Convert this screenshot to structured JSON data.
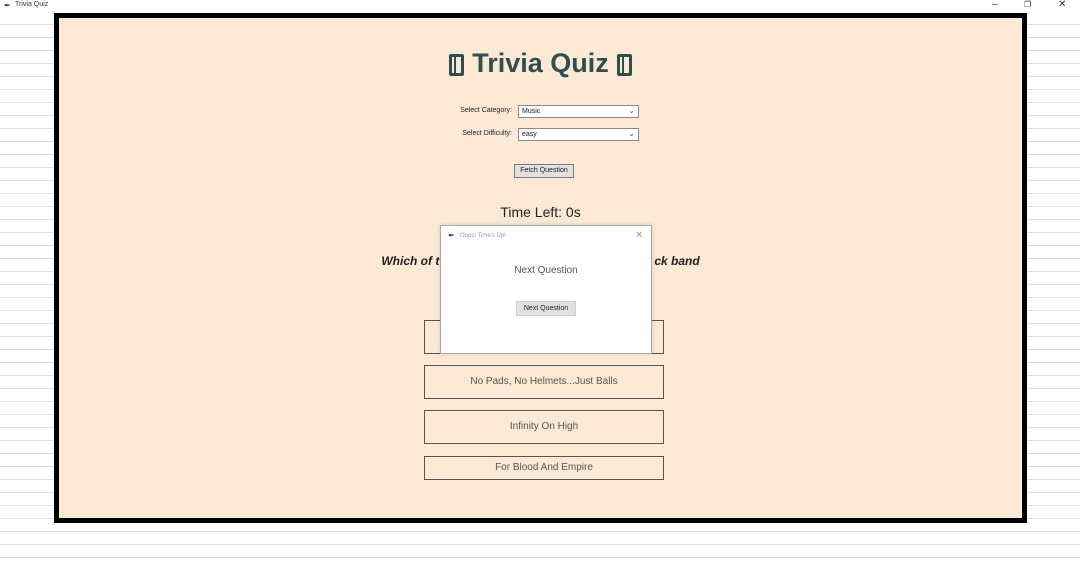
{
  "window": {
    "title": "Trivia Quiz",
    "controls": {
      "minimize": "–",
      "maximize": "❐",
      "close": "✕"
    }
  },
  "app": {
    "title": "Trivia Quiz",
    "category_label": "Select Category:",
    "category_value": "Music",
    "difficulty_label": "Select Difficulty:",
    "difficulty_value": "easy",
    "fetch_button": "Fetch Question",
    "time_left": "Time Left: 0s",
    "question_left": "Which of t",
    "question_right": "ck band",
    "answers": [
      "",
      "No Pads, No Helmets...Just Balls",
      "Infinity On High",
      "For Blood And Empire"
    ]
  },
  "dialog": {
    "title": "Oops! Time's Up!",
    "message": "Next Question",
    "button": "Next Question"
  },
  "colors": {
    "background": "#fbe9d6",
    "title": "#2f4f4f",
    "frame": "#000000"
  }
}
